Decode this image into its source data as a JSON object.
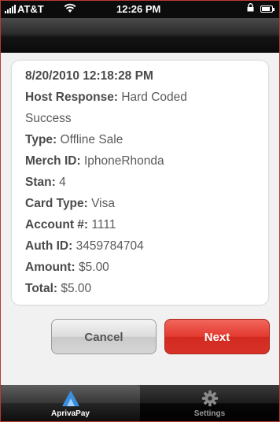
{
  "status_bar": {
    "carrier": "AT&T",
    "time": "12:26 PM"
  },
  "transaction": {
    "timestamp": "8/20/2010 12:18:28 PM",
    "fields": [
      {
        "label": "Host Response:",
        "value": "Hard Coded"
      },
      {
        "label": "",
        "value": "Success"
      },
      {
        "label": "Type:",
        "value": "Offline Sale"
      },
      {
        "label": "Merch ID:",
        "value": "IphoneRhonda"
      },
      {
        "label": "Stan:",
        "value": "4"
      },
      {
        "label": "Card Type:",
        "value": "Visa"
      },
      {
        "label": "Account #:",
        "value": "1111"
      },
      {
        "label": "Auth ID:",
        "value": "3459784704"
      },
      {
        "label": "Amount:",
        "value": "$5.00"
      },
      {
        "label": "Total:",
        "value": "$5.00"
      }
    ]
  },
  "buttons": {
    "cancel_label": "Cancel",
    "next_label": "Next"
  },
  "tab_bar": {
    "tabs": [
      {
        "label": "AprivaPay",
        "icon": "apriva-logo-icon",
        "selected": true
      },
      {
        "label": "Settings",
        "icon": "gear-icon",
        "selected": false
      }
    ]
  },
  "colors": {
    "next_button": "#e03228",
    "selected_tab_icon": "#3a8fe0",
    "frame_border": "#b83a32"
  }
}
